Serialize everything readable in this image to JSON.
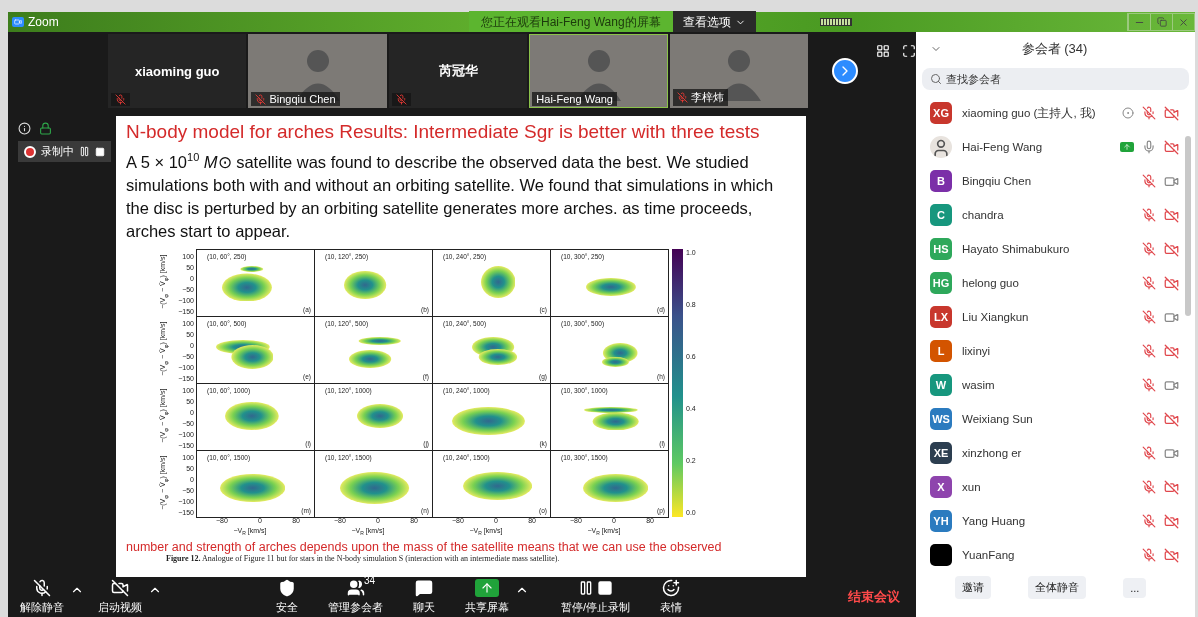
{
  "title_bar": {
    "app": "Zoom",
    "banner": "您正在观看Hai-Feng Wang的屏幕",
    "view_options": "查看选项"
  },
  "video_tiles": [
    {
      "name": "xiaoming guo",
      "kind": "name",
      "muted": true,
      "active": false
    },
    {
      "name": "Bingqiu Chen",
      "kind": "video",
      "muted": true,
      "active": false
    },
    {
      "name": "芮冠华",
      "kind": "name",
      "muted": true,
      "active": false
    },
    {
      "name": "Hai-Feng Wang",
      "kind": "video",
      "muted": false,
      "active": true
    },
    {
      "name": "李梓炜",
      "kind": "video",
      "muted": true,
      "active": false
    }
  ],
  "recording": {
    "label": "录制中"
  },
  "slide": {
    "title": "N-body model for arches Results: Intermediate Sgr is better with three tests",
    "body": "A 5 × 10$^{10}$ *M*⊙ satellite was found to describe the observed data the best. We studied simulations both with and without an orbiting satellite. We found that simulations in which the disc is perturbed by an orbiting satellite generates more arches. as time proceeds, arches start to appear.",
    "figure": {
      "rows": [
        {
          "ylabel": "−(V$_{φ}$ − V̄$_{φ}$) [km/s]",
          "yticks": [
            "100",
            "50",
            "0",
            "−50",
            "−100",
            "−150"
          ],
          "panels": [
            {
              "title": "(10, 60°, 250)",
              "tag": "(a)"
            },
            {
              "title": "(10, 120°, 250)",
              "tag": "(b)"
            },
            {
              "title": "(10, 240°, 250)",
              "tag": "(c)"
            },
            {
              "title": "(10, 300°, 250)",
              "tag": "(d)"
            }
          ]
        },
        {
          "ylabel": "−(V$_{φ}$ − V̄$_{φ}$) [km/s]",
          "yticks": [
            "100",
            "50",
            "0",
            "−50",
            "−100",
            "−150"
          ],
          "panels": [
            {
              "title": "(10, 60°, 500)",
              "tag": "(e)"
            },
            {
              "title": "(10, 120°, 500)",
              "tag": "(f)"
            },
            {
              "title": "(10, 240°, 500)",
              "tag": "(g)"
            },
            {
              "title": "(10, 300°, 500)",
              "tag": "(h)"
            }
          ]
        },
        {
          "ylabel": "−(V$_{φ}$ − V̄$_{φ}$) [km/s]",
          "yticks": [
            "100",
            "50",
            "0",
            "−50",
            "−100",
            "−150"
          ],
          "panels": [
            {
              "title": "(10, 60°, 1000)",
              "tag": "(i)"
            },
            {
              "title": "(10, 120°, 1000)",
              "tag": "(j)"
            },
            {
              "title": "(10, 240°, 1000)",
              "tag": "(k)"
            },
            {
              "title": "(10, 300°, 1000)",
              "tag": "(l)"
            }
          ]
        },
        {
          "ylabel": "−(V$_{φ}$ − V̄$_{φ}$) [km/s]",
          "yticks": [
            "100",
            "50",
            "0",
            "−50",
            "−100",
            "−150"
          ],
          "panels": [
            {
              "title": "(10, 60°, 1500)",
              "tag": "(m)"
            },
            {
              "title": "(10, 120°, 1500)",
              "tag": "(n)"
            },
            {
              "title": "(10, 240°, 1500)",
              "tag": "(o)"
            },
            {
              "title": "(10, 300°, 1500)",
              "tag": "(p)"
            }
          ]
        }
      ],
      "columns": [
        {
          "xticks": [
            "−80",
            "0",
            "80"
          ],
          "xlabel": "−V$_{R}$ [km/s]"
        },
        {
          "xticks": [
            "−80",
            "0",
            "80"
          ],
          "xlabel": "−V$_{R}$ [km/s]"
        },
        {
          "xticks": [
            "−80",
            "0",
            "80"
          ],
          "xlabel": "−V$_{R}$ [km/s]"
        },
        {
          "xticks": [
            "−80",
            "0",
            "80"
          ],
          "xlabel": "−V$_{R}$ [km/s]"
        }
      ],
      "colorbar_ticks": [
        "1.0",
        "0.8",
        "0.6",
        "0.4",
        "0.2",
        "0.0"
      ]
    },
    "footer": "number and strength of arches depends upon the mass of the satellite means that we can use the observed",
    "caption": "**Figure 12.** Analogue of Figure 11 but for stars in the N-body simulation S (interaction with an intermediate mass satellite)."
  },
  "toolbar": {
    "items": [
      {
        "kind": "mic_off",
        "label": "解除静音",
        "caret": true
      },
      {
        "kind": "video_off",
        "label": "启动视频",
        "caret": true
      },
      {
        "kind": "shield",
        "label": "安全",
        "caret": false
      },
      {
        "kind": "participants",
        "label": "管理参会者",
        "caret": false,
        "badge": "34"
      },
      {
        "kind": "chat",
        "label": "聊天",
        "caret": false
      },
      {
        "kind": "share",
        "label": "共享屏幕",
        "caret": true
      },
      {
        "kind": "record",
        "label": "暂停/停止录制",
        "caret": false
      },
      {
        "kind": "emoji",
        "label": "表情",
        "caret": false
      }
    ],
    "end_button": "结束会议"
  },
  "panel": {
    "title": "参会者 (34)",
    "search": {
      "placeholder": "查找参会者"
    },
    "participants": [
      {
        "kind": "initials",
        "initials": "XG",
        "color": "#c8372d",
        "name": "xiaoming guo (主持人, 我)",
        "recording": true,
        "sharing": false,
        "mic_muted": true,
        "video_on": false
      },
      {
        "kind": "photo",
        "name": "Hai-Feng Wang",
        "recording": false,
        "sharing": true,
        "mic_muted": false,
        "video_on": false
      },
      {
        "kind": "initials",
        "initials": "B",
        "color": "#7b2fa8",
        "name": "Bingqiu Chen",
        "recording": false,
        "sharing": false,
        "mic_muted": true,
        "video_on": true
      },
      {
        "kind": "initials",
        "initials": "C",
        "color": "#17977e",
        "name": "chandra",
        "recording": false,
        "sharing": false,
        "mic_muted": true,
        "video_on": false
      },
      {
        "kind": "initials",
        "initials": "HS",
        "color": "#2ea85b",
        "name": "Hayato Shimabukuro",
        "recording": false,
        "sharing": false,
        "mic_muted": true,
        "video_on": false
      },
      {
        "kind": "initials",
        "initials": "HG",
        "color": "#2ea85b",
        "name": "helong guo",
        "recording": false,
        "sharing": false,
        "mic_muted": true,
        "video_on": false
      },
      {
        "kind": "initials",
        "initials": "LX",
        "color": "#c8372d",
        "name": "Liu Xiangkun",
        "recording": false,
        "sharing": false,
        "mic_muted": true,
        "video_on": true
      },
      {
        "kind": "initials",
        "initials": "L",
        "color": "#d35400",
        "name": "lixinyi",
        "recording": false,
        "sharing": false,
        "mic_muted": true,
        "video_on": false
      },
      {
        "kind": "initials",
        "initials": "W",
        "color": "#17977e",
        "name": "wasim",
        "recording": false,
        "sharing": false,
        "mic_muted": true,
        "video_on": true
      },
      {
        "kind": "initials",
        "initials": "WS",
        "color": "#2b7bbf",
        "name": "Weixiang Sun",
        "recording": false,
        "sharing": false,
        "mic_muted": true,
        "video_on": false
      },
      {
        "kind": "initials",
        "initials": "XE",
        "color": "#2c3e50",
        "name": "xinzhong er",
        "recording": false,
        "sharing": false,
        "mic_muted": true,
        "video_on": true
      },
      {
        "kind": "initials",
        "initials": "X",
        "color": "#8e44ad",
        "name": "xun",
        "recording": false,
        "sharing": false,
        "mic_muted": true,
        "video_on": false
      },
      {
        "kind": "initials",
        "initials": "YH",
        "color": "#2b7bbf",
        "name": "Yang Huang",
        "recording": false,
        "sharing": false,
        "mic_muted": true,
        "video_on": false
      },
      {
        "kind": "initials",
        "color": "#000000",
        "name": "YuanFang",
        "recording": false,
        "sharing": false,
        "mic_muted": true,
        "video_on": false
      }
    ],
    "buttons": [
      "邀请",
      "全体静音",
      "..."
    ]
  }
}
